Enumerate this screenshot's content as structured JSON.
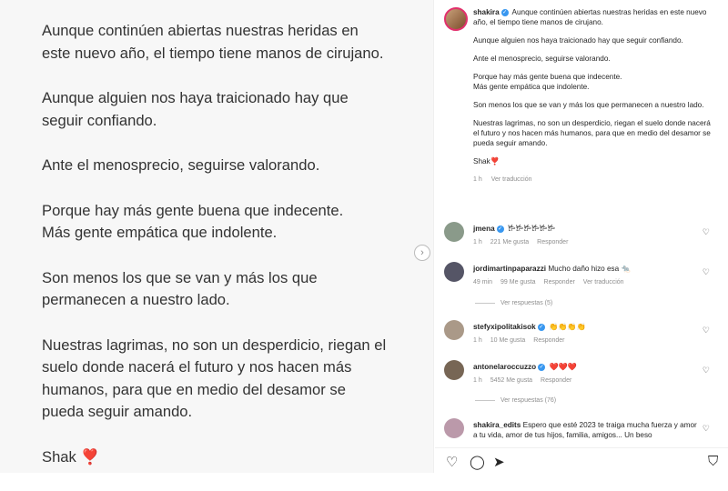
{
  "post": {
    "paragraphs": [
      "Aunque continúen abiertas nuestras heridas en\neste nuevo año, el tiempo tiene manos de cirujano.",
      "Aunque alguien nos haya traicionado hay que\nseguir confiando.",
      "Ante el menosprecio, seguirse valorando.",
      "Porque hay más gente buena que indecente.\nMás gente empática que indolente.",
      "Son menos los que se van y más los que\npermanecen a nuestro lado.",
      "Nuestras lagrimas, no son un desperdicio, riegan el\nsuelo donde nacerá el futuro y nos hacen más\nhumanos, para que en medio del desamor se\npueda seguir amando."
    ],
    "signature": "Shak",
    "signature_emoji": "❣️",
    "next_icon": "chevron-right-icon"
  },
  "caption": {
    "username": "shakira",
    "p1": "Aunque continúen abiertas nuestras heridas en este nuevo año, el tiempo tiene manos de cirujano.",
    "p2": "Aunque alguien nos haya traicionado hay que seguir confiando.",
    "p3": "Ante el menosprecio, seguirse valorando.",
    "p4": "Porque hay más gente buena que indecente.\nMás gente empática que indolente.",
    "p5": "Son menos los que se van y más los que permanecen a nuestro lado.",
    "p6": "Nuestras lagrimas, no son un desperdicio, riegan el suelo donde nacerá el futuro y nos hacen más humanos, para que en medio del desamor se pueda seguir amando.",
    "signature": "Shak❣️",
    "time": "1 h",
    "translate": "Ver traducción"
  },
  "comments": [
    {
      "user": "jmena",
      "text": "𐂂𐂂𐂂𐂂𐂂𐂂",
      "time": "1 h",
      "likes": "221 Me gusta",
      "reply": "Responder",
      "verified": true
    },
    {
      "user": "jordimartinpaparazzi",
      "text": "Mucho daño hizo esa 🐀",
      "time": "49 min",
      "likes": "99 Me gusta",
      "reply": "Responder",
      "translate": "Ver traducción",
      "replies": "Ver respuestas (5)"
    },
    {
      "user": "stefyxipolitakisok",
      "text": "👏👏👏👏",
      "time": "1 h",
      "likes": "10 Me gusta",
      "reply": "Responder",
      "verified": true
    },
    {
      "user": "antonelaroccuzzo",
      "text": "❤️❤️❤️",
      "time": "1 h",
      "likes": "5452 Me gusta",
      "reply": "Responder",
      "verified": true,
      "replies": "Ver respuestas (76)"
    },
    {
      "user": "shakira_edits",
      "text": "Espero que esté 2023 te traiga mucha fuerza y amor a tu vida, amor de tus hijos, familia, amigos... Un beso"
    }
  ],
  "actions": {
    "like": "heart-icon",
    "comment": "comment-icon",
    "share": "send-icon",
    "save": "bookmark-icon"
  }
}
